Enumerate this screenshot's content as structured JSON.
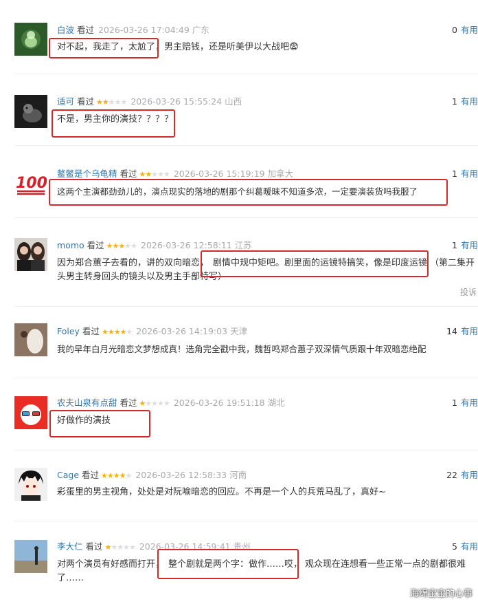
{
  "comments": [
    {
      "user": "白波",
      "status": "看过",
      "stars": 0,
      "time": "2026-03-26 17:04:49",
      "location": "广东",
      "votes": "0",
      "vote_label": "有用",
      "text": "对不起，我走了，太尬了，男主赔钱，还是听美伊以大战吧😨"
    },
    {
      "user": "适可",
      "status": "看过",
      "stars": 2,
      "time": "2026-03-26 15:55:24",
      "location": "山西",
      "votes": "1",
      "vote_label": "有用",
      "text": "不是，男主你的演技？？？？"
    },
    {
      "user": "鳖鳖是个乌龟精",
      "status": "看过",
      "stars": 2,
      "time": "2026-03-26 15:19:19",
      "location": "加拿大",
      "votes": "1",
      "vote_label": "有用",
      "text": "这两个主演都劲劲儿的，演点现实的落地的剧那个纠葛暧昧不知道多浓，一定要演装货吗我服了"
    },
    {
      "user": "momo",
      "status": "看过",
      "stars": 3,
      "time": "2026-03-26 12:58:11",
      "location": "江苏",
      "votes": "1",
      "vote_label": "有用",
      "text_a": "因为郑合蕙子去看的，讲的双向暗恋，",
      "text_b": "剧情中规中矩吧。剧里面的运镜特搞笑，像是印度运镜",
      "text_c": "（第二集开头男主转身回头的镜头以及男主手部特写）",
      "report": "投诉"
    },
    {
      "user": "Foley",
      "status": "看过",
      "stars": 4,
      "time": "2026-03-26 14:19:03",
      "location": "天津",
      "votes": "14",
      "vote_label": "有用",
      "text": "我的早年白月光暗恋文梦想成真！选角完全戳中我，魏哲鸣郑合蕙子双深情气质跟十年双暗恋绝配"
    },
    {
      "user": "农夫山泉有点甜",
      "status": "看过",
      "stars": 1,
      "time": "2026-03-26 19:51:18",
      "location": "湖北",
      "votes": "1",
      "vote_label": "有用",
      "text": "好做作的演技"
    },
    {
      "user": "Cage",
      "status": "看过",
      "stars": 4,
      "time": "2026-03-26 12:58:33",
      "location": "河南",
      "votes": "22",
      "vote_label": "有用",
      "text": "彩蛋里的男主视角，处处是对阮喻暗恋的回应。不再是一个人的兵荒马乱了，真好~"
    },
    {
      "user": "李大仁",
      "status": "看过",
      "stars": 1,
      "time": "2026-03-26 14:59:41",
      "location": "贵州",
      "votes": "5",
      "vote_label": "有用",
      "text_a": "对两个演员有好感而打开，",
      "text_b": "整个剧就是两个字：做作……哎，",
      "text_c": "观众现在连想看一些正常一点的剧都很难了……"
    }
  ],
  "avatar_badge": "100",
  "watermark": "海绵宝宝的心事",
  "colors": {
    "link": "#3377aa",
    "star": "#f5b10d",
    "highlight": "#d62a2a",
    "muted": "#aaaaaa"
  }
}
